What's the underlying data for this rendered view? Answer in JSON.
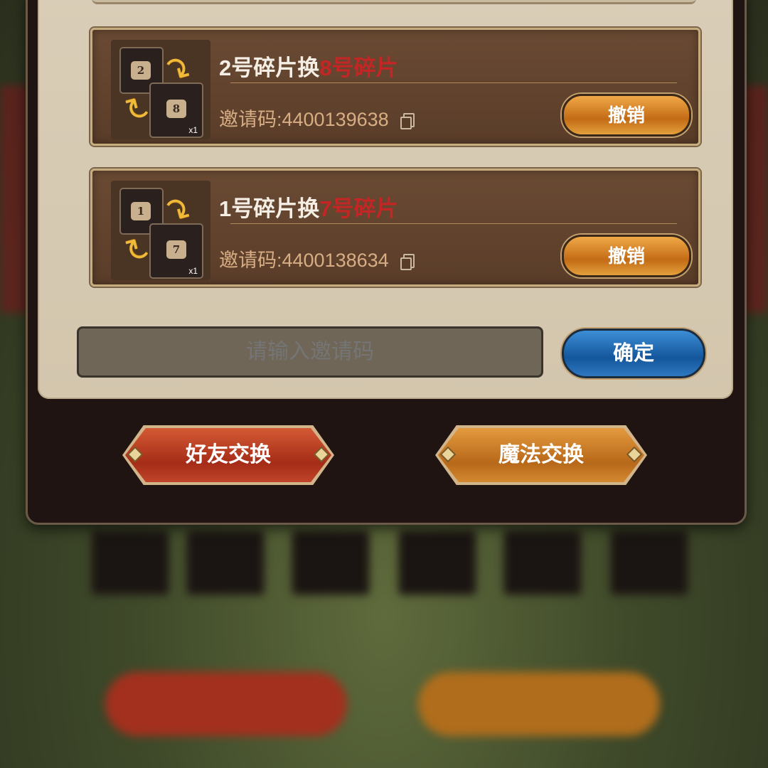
{
  "exchanges": [
    {
      "give_label": "2号碎片换",
      "get_label": "8号碎片",
      "give_piece": "2",
      "get_piece": "8",
      "quantity": "x1",
      "invite_code": "邀请码:4400139638",
      "action_label": "撤销"
    },
    {
      "give_label": "1号碎片换",
      "get_label": "7号碎片",
      "give_piece": "1",
      "get_piece": "7",
      "quantity": "x1",
      "invite_code": "邀请码:4400138634",
      "action_label": "撤销"
    }
  ],
  "code_input": {
    "placeholder": "请输入邀请码",
    "confirm_label": "确定"
  },
  "tabs": {
    "friend_exchange": "好友交换",
    "magic_exchange": "魔法交换"
  }
}
